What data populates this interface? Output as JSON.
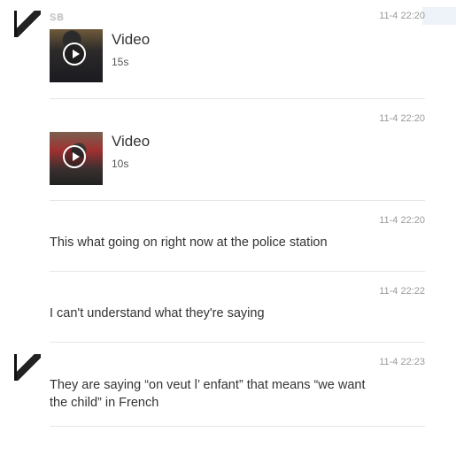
{
  "messages": [
    {
      "username": "SB_ _ _ _",
      "time": "11-4 22:20",
      "type": "video",
      "video_label": "Video",
      "duration": "15s"
    },
    {
      "username": "_ _ _ _ _ _ _",
      "time": "11-4 22:20",
      "type": "video",
      "video_label": "Video",
      "duration": "10s"
    },
    {
      "username": "_ _ _ _ _ _",
      "time": "11-4 22:20",
      "type": "text",
      "text": "This what going on right now at the police station"
    },
    {
      "username": "_ _ _ _ _ _",
      "time": "11-4 22:22",
      "type": "text",
      "text": "I can't understand what they're saying"
    },
    {
      "username": "_ _ _ _ _ _",
      "time": "11-4 22:23",
      "type": "text",
      "text": "They are saying “on veut l’ enfant” that means “we want the child” in French"
    }
  ]
}
